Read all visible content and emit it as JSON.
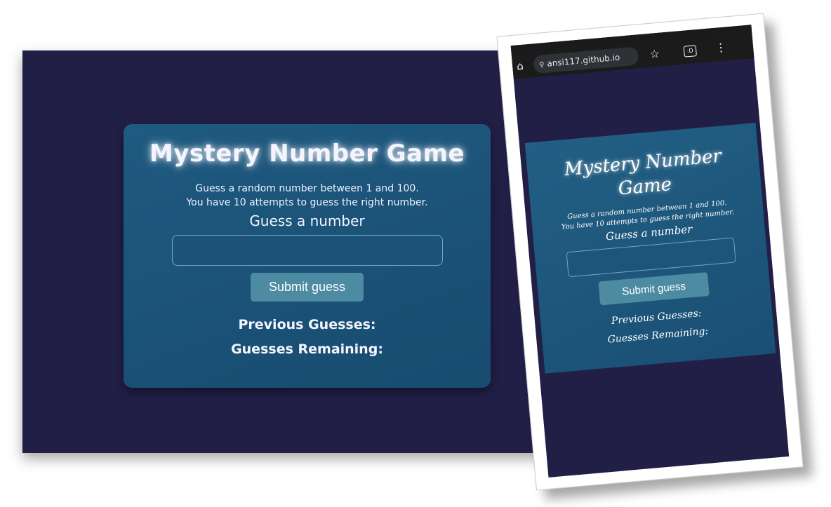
{
  "game": {
    "title": "Mystery Number Game",
    "info_line1": "Guess a random number between 1 and 100.",
    "info_line2": "You have 10 attempts to guess the right number.",
    "guess_label": "Guess a number",
    "guess_input_value": "",
    "submit_label": "Submit guess",
    "previous_guesses_label": "Previous Guesses:",
    "guesses_remaining_label": "Guesses Remaining:"
  },
  "mobile": {
    "url": "ansi117.github.io",
    "title_line1": "Mystery Number",
    "title_line2": "Game",
    "icons": {
      "home": "home-icon",
      "site_info": "site-info-icon",
      "bookmark": "star-icon",
      "tabs": "tabs-icon",
      "menu": "menu-icon"
    },
    "tabs_badge": ":D"
  },
  "colors": {
    "page_background": "#221f47",
    "card_background": "#1f5a80",
    "button_background": "#4d8ba3",
    "input_border": "#6fa7c0",
    "text": "#ffffff"
  }
}
